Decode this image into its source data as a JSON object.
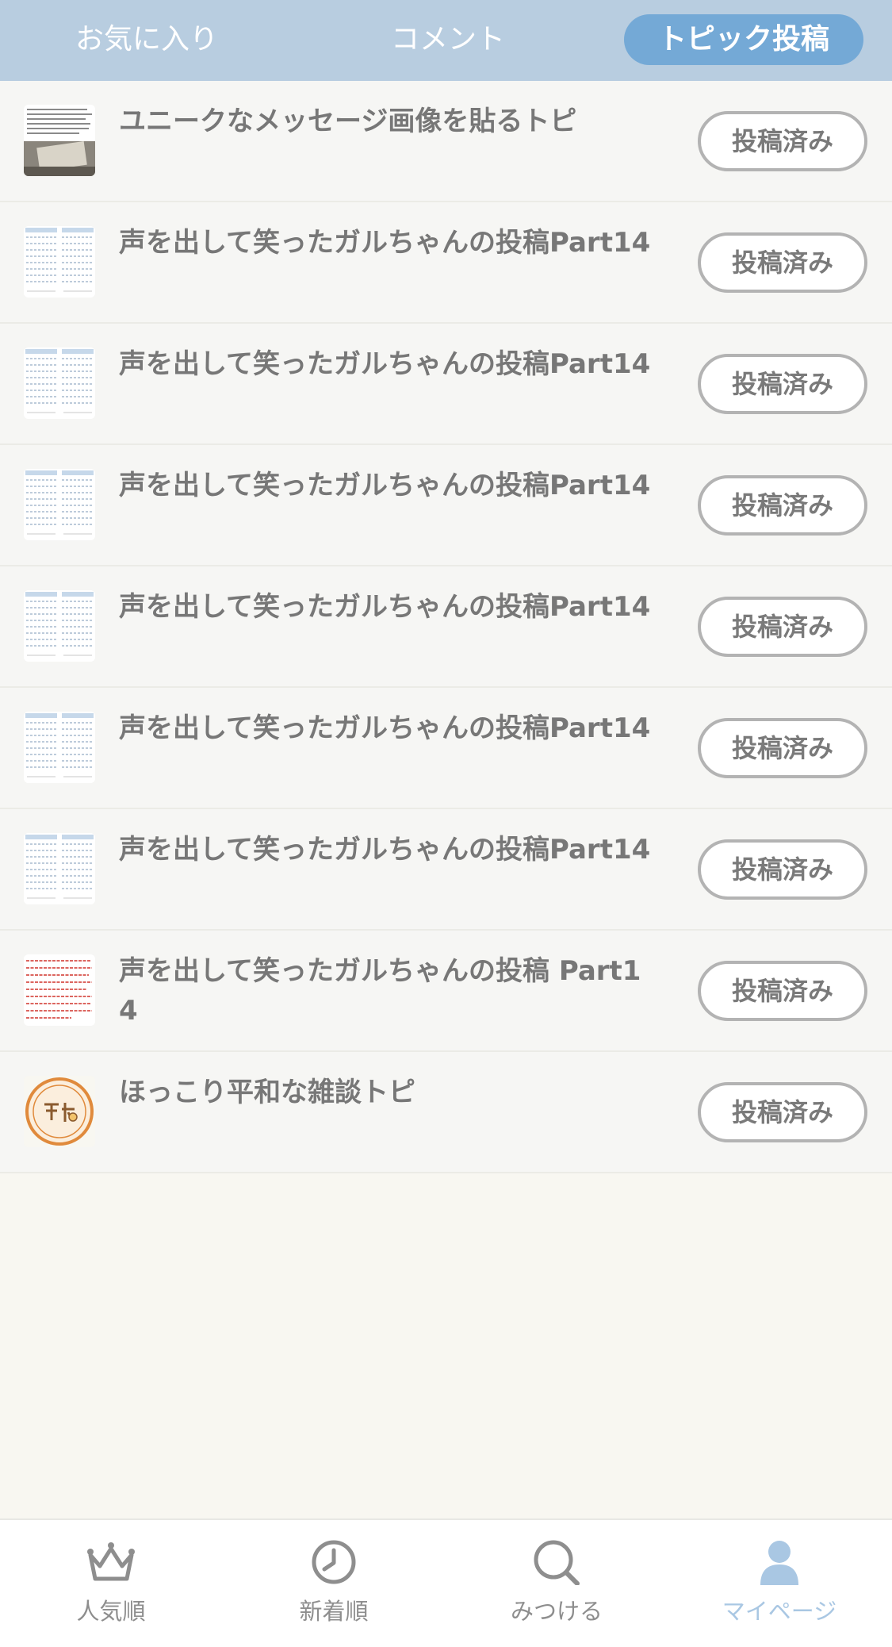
{
  "tabs": {
    "favorites": "お気に入り",
    "comments": "コメント",
    "topic_posts": "トピック投稿"
  },
  "posted_label": "投稿済み",
  "topics": [
    {
      "title": "ユニークなメッセージ画像を貼るトピ",
      "thumb": "message-photo"
    },
    {
      "title": "声を出して笑ったガルちゃんの投稿Part14",
      "thumb": "text-collage"
    },
    {
      "title": "声を出して笑ったガルちゃんの投稿Part14",
      "thumb": "text-collage"
    },
    {
      "title": "声を出して笑ったガルちゃんの投稿Part14",
      "thumb": "text-collage"
    },
    {
      "title": "声を出して笑ったガルちゃんの投稿Part14",
      "thumb": "text-collage"
    },
    {
      "title": "声を出して笑ったガルちゃんの投稿Part14",
      "thumb": "text-collage"
    },
    {
      "title": "声を出して笑ったガルちゃんの投稿Part14",
      "thumb": "text-collage"
    },
    {
      "title": "声を出して笑ったガルちゃんの投稿 Part14",
      "thumb": "red-text-note"
    },
    {
      "title": "ほっこり平和な雑談トピ",
      "thumb": "heiwa-logo"
    }
  ],
  "bottom_nav": {
    "popular": "人気順",
    "newest": "新着順",
    "find": "みつける",
    "mypage": "マイページ"
  },
  "colors": {
    "header_bg": "#b8cde0",
    "active_tab": "#74a9d6",
    "active_nav": "#a9c7e3"
  }
}
